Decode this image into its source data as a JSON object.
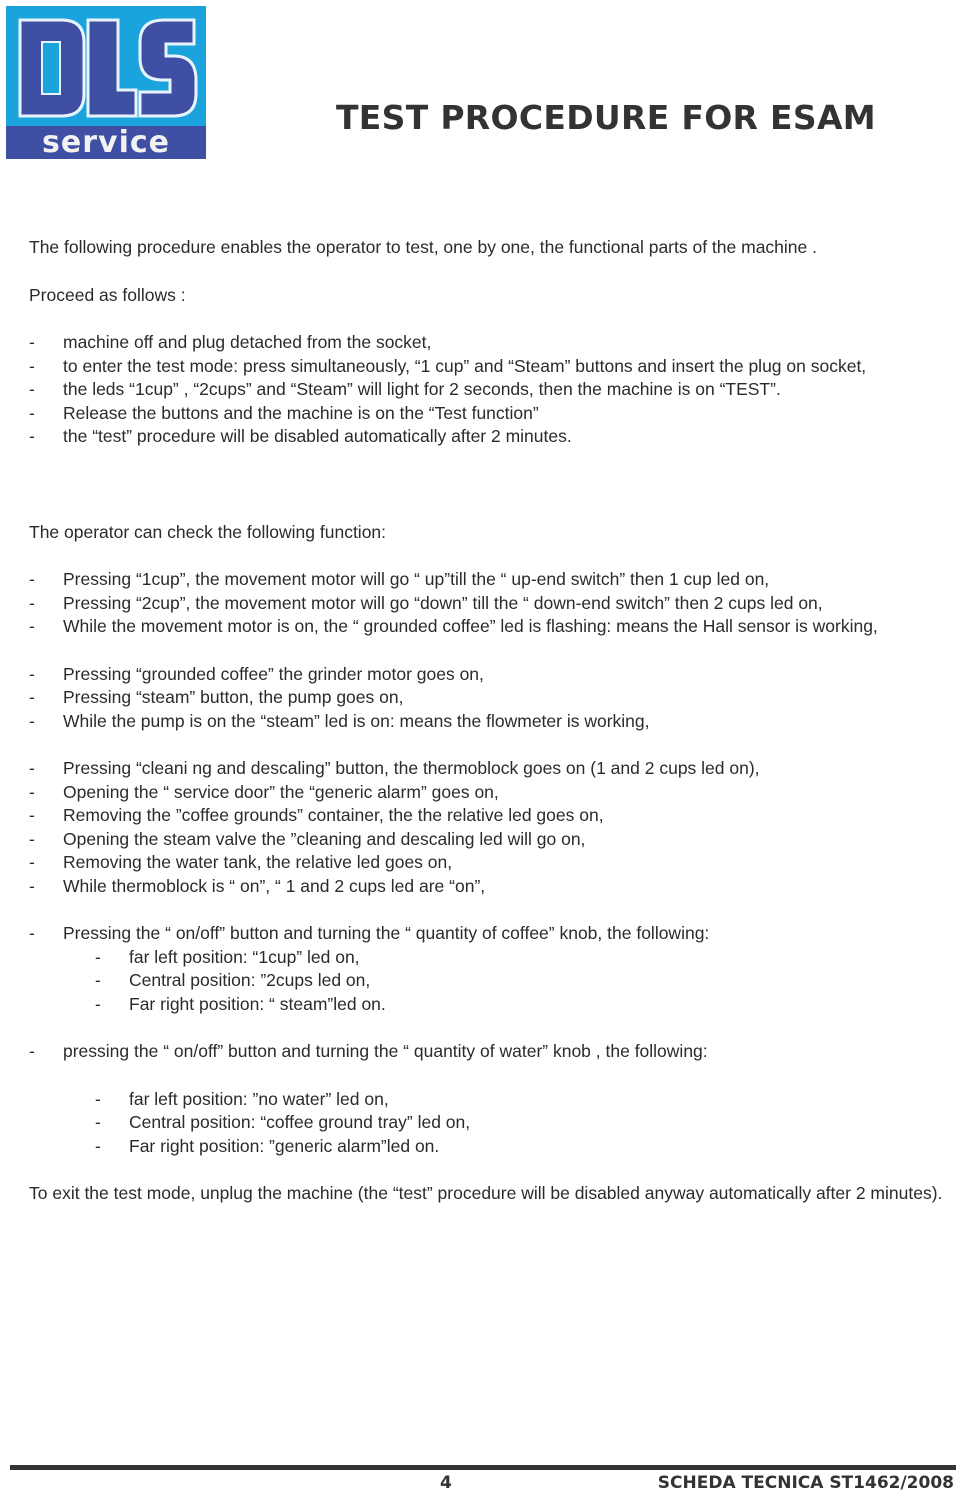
{
  "logo": {
    "letters": "DLS",
    "subtitle": "service",
    "colors": {
      "background": "#1aa3dd",
      "letters": "#3f4fa3",
      "band": "#3f4fa3",
      "text": "#f2f2f2"
    }
  },
  "header": {
    "title": "TEST PROCEDURE FOR ESAM"
  },
  "intro": {
    "paragraph": "The following procedure enables the operator to test, one by one, the functional parts of the machine .",
    "proceed": "Proceed as follows :"
  },
  "steps": [
    "machine off and plug detached from the socket,",
    "to enter the test mode: press simultaneously, “1 cup” and “Steam” buttons and insert the plug on socket,",
    "the leds “1cup” , “2cups” and “Steam” will light for 2 seconds, then the machine is on “TEST”.",
    "Release the buttons and the machine is on the “Test function”",
    "the “test” procedure will be disabled automatically after 2 minutes."
  ],
  "checks": {
    "heading": "The operator can check the following function:",
    "group1": [
      "Pressing “1cup”, the movement motor will go “ up”till the “ up-end switch” then 1 cup led on,",
      "Pressing “2cup”, the movement motor will go “down” till the “ down-end switch” then 2 cups led on,",
      "While the movement motor is on, the “ grounded coffee” led is flashing: means the Hall sensor is working,"
    ],
    "group2": [
      "Pressing “grounded coffee” the grinder motor goes on,",
      "Pressing “steam” button, the pump goes on,",
      "While the pump is on the “steam” led is on: means the flowmeter is working,"
    ],
    "group3": [
      "Pressing “cleani ng and descaling” button, the thermoblock goes on (1 and 2 cups led on),",
      "Opening the “ service door” the “generic alarm” goes on,",
      "Removing the ”coffee grounds” container, the the relative led goes on,",
      "Opening the steam valve the ”cleaning and descaling led will go on,",
      "Removing the water tank, the relative led goes on,",
      "While thermoblock is “ on”, “ 1 and 2 cups led are “on”,"
    ],
    "coffee_knob": {
      "lead": "Pressing the “ on/off” button and turning the “ quantity of coffee” knob, the following:",
      "positions": [
        "far left position: “1cup” led on,",
        "Central position: ”2cups led on,",
        "Far right position: “ steam”led on."
      ]
    },
    "water_knob": {
      "lead": "pressing the “ on/off” button and turning the “ quantity of water” knob , the following:",
      "positions": [
        "far left position: ”no water” led on,",
        "Central position: “coffee ground tray” led on,",
        "Far right position: ”generic alarm”led on."
      ]
    }
  },
  "exit_note": "To exit the test mode, unplug the machine (the “test” procedure will be disabled anyway automatically after 2 minutes).",
  "footer": {
    "page_number": "4",
    "document_ref": "SCHEDA TECNICA ST1462/2008"
  }
}
